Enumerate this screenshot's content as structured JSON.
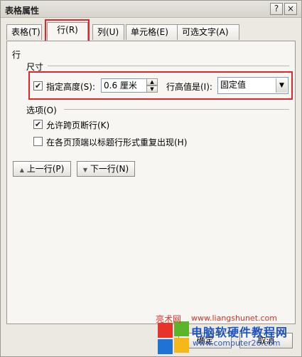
{
  "window": {
    "title": "表格属性",
    "help_button": "?",
    "close_button": "×"
  },
  "tabs": [
    {
      "label": "表格(T)",
      "active": false
    },
    {
      "label": "行(R)",
      "active": true
    },
    {
      "label": "列(U)",
      "active": false
    },
    {
      "label": "单元格(E)",
      "active": false
    },
    {
      "label": "可选文字(A)",
      "active": false
    }
  ],
  "row_section": {
    "heading": "行",
    "size_label": "尺寸",
    "specify_height_label": "指定高度(S):",
    "specify_height_checked": true,
    "height_value": "0.6 厘米",
    "row_height_is_label": "行高值是(I):",
    "row_height_mode": "固定值"
  },
  "options": {
    "heading": "选项(O)",
    "allow_break_label": "允许跨页断行(K)",
    "allow_break_checked": true,
    "repeat_header_label": "在各页顶端以标题行形式重复出现(H)",
    "repeat_header_checked": false
  },
  "nav": {
    "prev_row": "上一行(P)",
    "next_row": "下一行(N)"
  },
  "footer": {
    "ok": "确定",
    "cancel": "取消"
  },
  "watermark": {
    "site_left": "亮术网",
    "url_top": "www.liangshunet.com",
    "brand": "电脑软硬件教程网",
    "url_bottom": "www.computer26.com"
  },
  "colors": {
    "highlight": "#e0262a",
    "watermark_blue": "#1c53c9",
    "watermark_red": "#e8332a"
  }
}
